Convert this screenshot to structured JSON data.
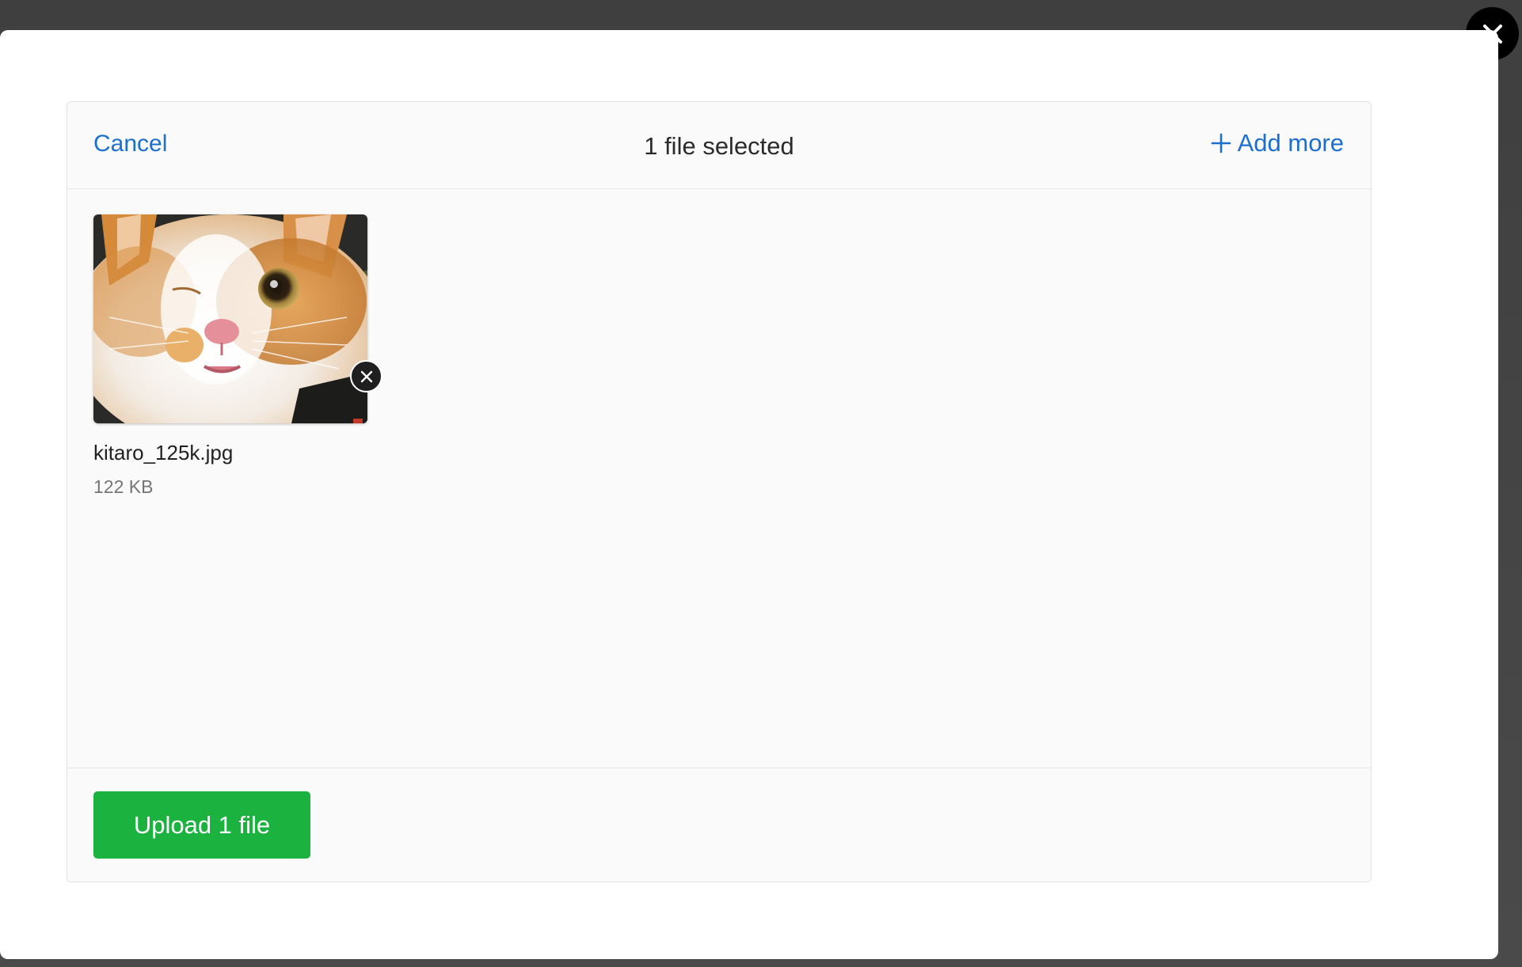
{
  "modal": {
    "close_icon": "close-icon"
  },
  "topbar": {
    "cancel_label": "Cancel",
    "title": "1 file selected",
    "add_more_icon": "plus-icon",
    "add_more_label": "Add more"
  },
  "files": [
    {
      "name": "kitaro_125k.jpg",
      "size": "122 KB",
      "thumbnail": "cat-photo",
      "remove_icon": "close-icon"
    }
  ],
  "footer": {
    "upload_label": "Upload 1 file"
  },
  "colors": {
    "accent_link": "#1d6fcf",
    "upload_button": "#1bb240",
    "backdrop": "#474747",
    "panel": "#fafafa"
  }
}
